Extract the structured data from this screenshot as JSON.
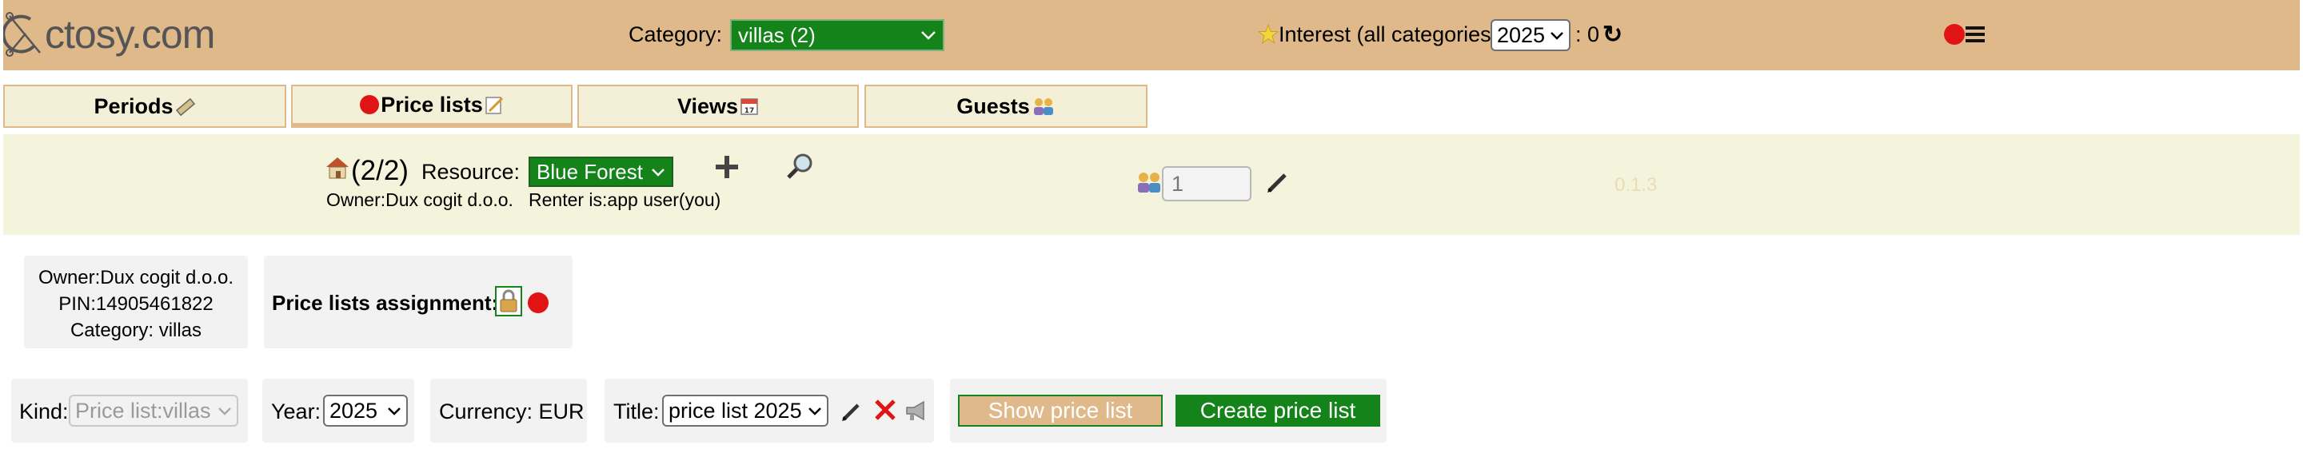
{
  "header": {
    "logo_text": "ctosy.com",
    "category_label": "Category:",
    "category_value": "villas (2)",
    "interest_label": "Interest (all categories)",
    "year_value": "2025",
    "interest_count": ": 0"
  },
  "tabs": [
    {
      "label": "Periods"
    },
    {
      "label": "Price lists"
    },
    {
      "label": "Views"
    },
    {
      "label": "Guests"
    }
  ],
  "toolbar": {
    "resource_count": "(2/2)",
    "resource_label": "Resource:",
    "resource_value": "Blue Forest",
    "owner_text": "Owner:Dux cogit d.o.o.",
    "renter_text": "Renter is:app user(you)",
    "guests_value": "1",
    "version": "0.1.3"
  },
  "info_card": {
    "owner": "Owner:Dux cogit d.o.o.",
    "pin": "PIN:14905461822",
    "category": "Category: villas"
  },
  "assignment_card": {
    "label": "Price lists assignment:"
  },
  "filters": {
    "kind_label": "Kind:",
    "kind_value": "Price list:villas",
    "year_label": "Year:",
    "year_value": "2025",
    "currency_text": "Currency: EUR",
    "title_label": "Title:",
    "title_value": "price list 2025",
    "show_button": "Show price list",
    "create_button": "Create price list"
  },
  "colors": {
    "header_bg": "#dfb98a",
    "toolbar_bg": "#f4f3dc",
    "green": "#14831a",
    "red": "#e01414"
  },
  "icons": [
    "compass-logo-icon",
    "chevron-down-icon",
    "star-icon",
    "refresh-icon",
    "red-dot-icon",
    "hamburger-menu-icon",
    "ruler-icon",
    "memo-icon",
    "calendar-icon",
    "people-icon",
    "house-icon",
    "plus-icon",
    "magnifier-icon",
    "pencil-icon",
    "lock-icon",
    "close-x-icon",
    "megaphone-icon"
  ]
}
